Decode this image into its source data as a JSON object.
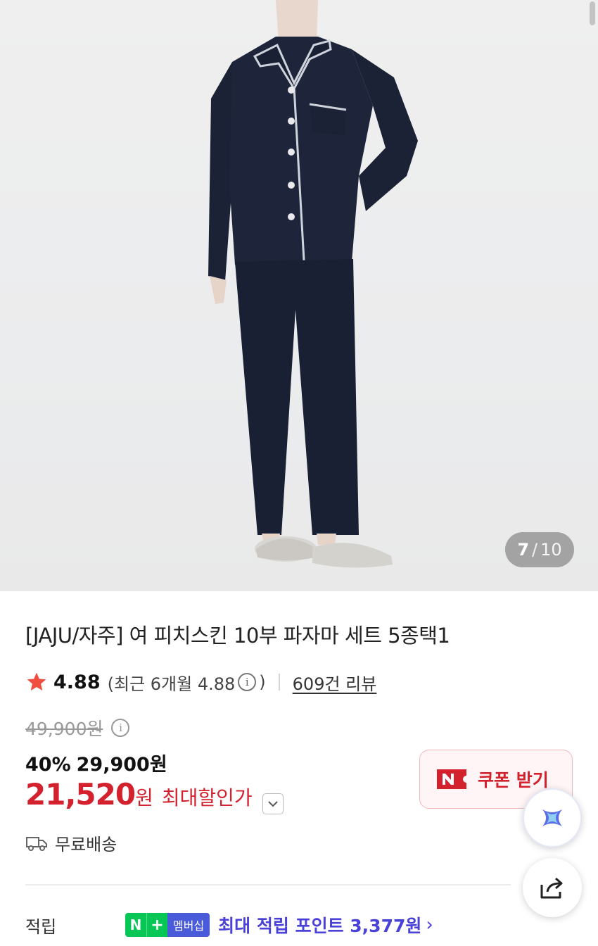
{
  "product_image": {
    "counter_current": "7",
    "counter_separator": "/",
    "counter_total": "10"
  },
  "product": {
    "title": "[JAJU/자주] 여 피치스킨 10부 파자마 세트 5종택1"
  },
  "rating": {
    "score": "4.88",
    "recent_label": "(최근 6개월 4.88",
    "recent_close": ")",
    "review_link": "609건 리뷰"
  },
  "price": {
    "original": "49,900원",
    "discount_percent": "40%",
    "sale_price": "29,900원",
    "max_discount_price": "21,520",
    "max_discount_unit": "원",
    "max_discount_label": "최대할인가"
  },
  "coupon": {
    "label": "쿠폰 받기"
  },
  "shipping": {
    "label": "무료배송"
  },
  "points": {
    "label": "적립",
    "badge_n": "N",
    "badge_plus": "+",
    "badge_membership": "멤버십",
    "text": "최대 적립 포인트 3,377원"
  },
  "colors": {
    "accent_red": "#d3222e",
    "points_purple": "#4a41d8",
    "naver_green": "#06c755",
    "star": "#f04e3e"
  }
}
